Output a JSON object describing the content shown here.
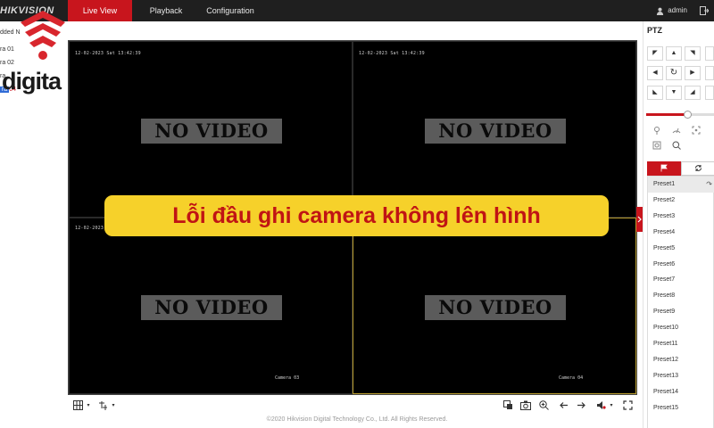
{
  "brand": "HIKVISION",
  "nav": {
    "tabs": [
      {
        "label": "Live View"
      },
      {
        "label": "Playback"
      },
      {
        "label": "Configuration"
      }
    ],
    "user": "admin"
  },
  "channels": {
    "root": "dded N",
    "items": [
      "ra 01",
      "ra 02",
      "ra",
      "ra"
    ],
    "highlight_suffix": "04"
  },
  "watermark_logo_text": "digita",
  "video": {
    "panes": [
      {
        "osd": "12-02-2023 Sat 13:42:39",
        "status": "NO VIDEO",
        "camera": ""
      },
      {
        "osd": "12-02-2023 Sat 13:42:39",
        "status": "NO VIDEO",
        "camera": ""
      },
      {
        "osd": "12-02-2023",
        "status": "NO VIDEO",
        "camera": ""
      },
      {
        "osd": "",
        "status": "NO VIDEO",
        "camera": "Camera 04"
      }
    ],
    "pane3_camera": "Camera 03"
  },
  "banner": "Lỗi đầu ghi camera không lên hình",
  "footer": "©2020 Hikvision Digital Technology Co., Ltd. All Rights Reserved.",
  "ptz": {
    "title": "PTZ",
    "zoom_level_fraction": 0.6,
    "presets": [
      "Preset1",
      "Preset2",
      "Preset3",
      "Preset4",
      "Preset5",
      "Preset6",
      "Preset7",
      "Preset8",
      "Preset9",
      "Preset10",
      "Preset11",
      "Preset12",
      "Preset13",
      "Preset14",
      "Preset15"
    ]
  },
  "colors": {
    "accent": "#c8151d",
    "banner_bg": "#f6d12a",
    "banner_text": "#c01414"
  }
}
